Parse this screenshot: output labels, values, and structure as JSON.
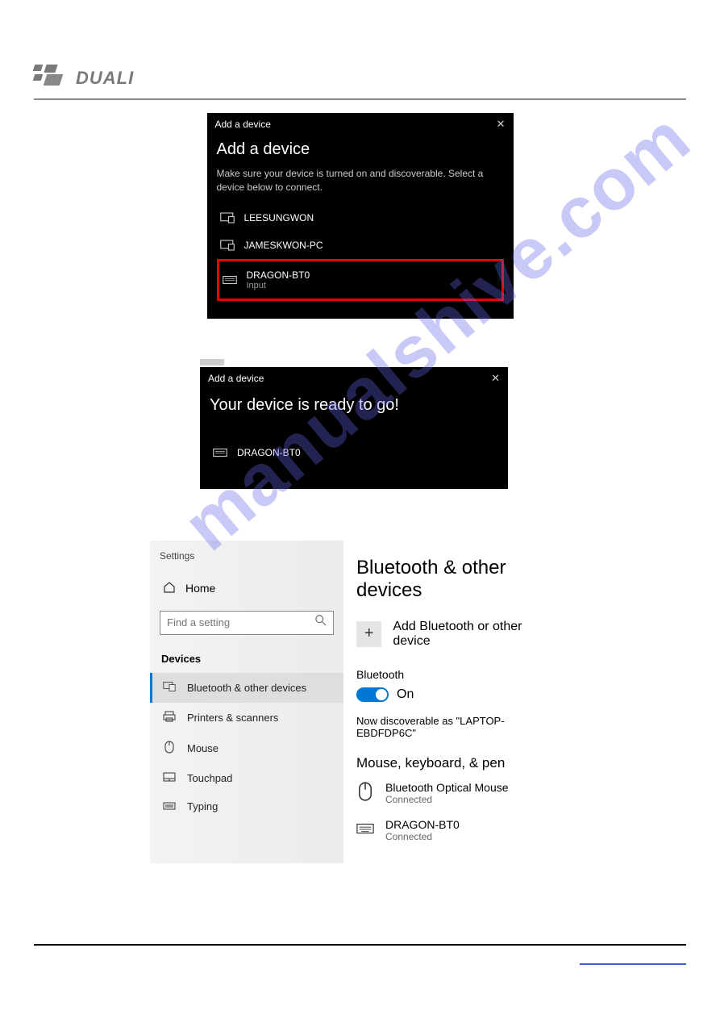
{
  "brand": {
    "name": "DUALI"
  },
  "watermark": "manualshive.com",
  "dialog1": {
    "window_title": "Add a device",
    "heading": "Add a device",
    "subtitle": "Make sure your device is turned on and discoverable. Select a device below to connect.",
    "devices": [
      {
        "name": "LEESUNGWON",
        "sub": "",
        "icon": "display-icon"
      },
      {
        "name": "JAMESKWON-PC",
        "sub": "",
        "icon": "display-icon"
      },
      {
        "name": "DRAGON-BT0",
        "sub": "Input",
        "icon": "keyboard-icon"
      }
    ]
  },
  "dialog2": {
    "window_title": "Add a device",
    "heading": "Your device is ready to go!",
    "device": {
      "name": "DRAGON-BT0",
      "icon": "keyboard-icon"
    }
  },
  "settings": {
    "app_label": "Settings",
    "home": "Home",
    "search_placeholder": "Find a setting",
    "group_label": "Devices",
    "nav": [
      {
        "label": "Bluetooth & other devices",
        "icon": "devices-icon",
        "active": true
      },
      {
        "label": "Printers & scanners",
        "icon": "printer-icon"
      },
      {
        "label": "Mouse",
        "icon": "mouse-icon"
      },
      {
        "label": "Touchpad",
        "icon": "touchpad-icon"
      },
      {
        "label": "Typing",
        "icon": "keyboard-icon"
      }
    ],
    "main": {
      "heading": "Bluetooth & other devices",
      "add_label": "Add Bluetooth or other device",
      "bt_label": "Bluetooth",
      "bt_state": "On",
      "discoverable": "Now discoverable as \"LAPTOP-EBDFDP6C\"",
      "section": "Mouse, keyboard, & pen",
      "devices": [
        {
          "name": "Bluetooth Optical Mouse",
          "status": "Connected",
          "icon": "mouse-icon"
        },
        {
          "name": "DRAGON-BT0",
          "status": "Connected",
          "icon": "keyboard-icon"
        }
      ]
    }
  }
}
